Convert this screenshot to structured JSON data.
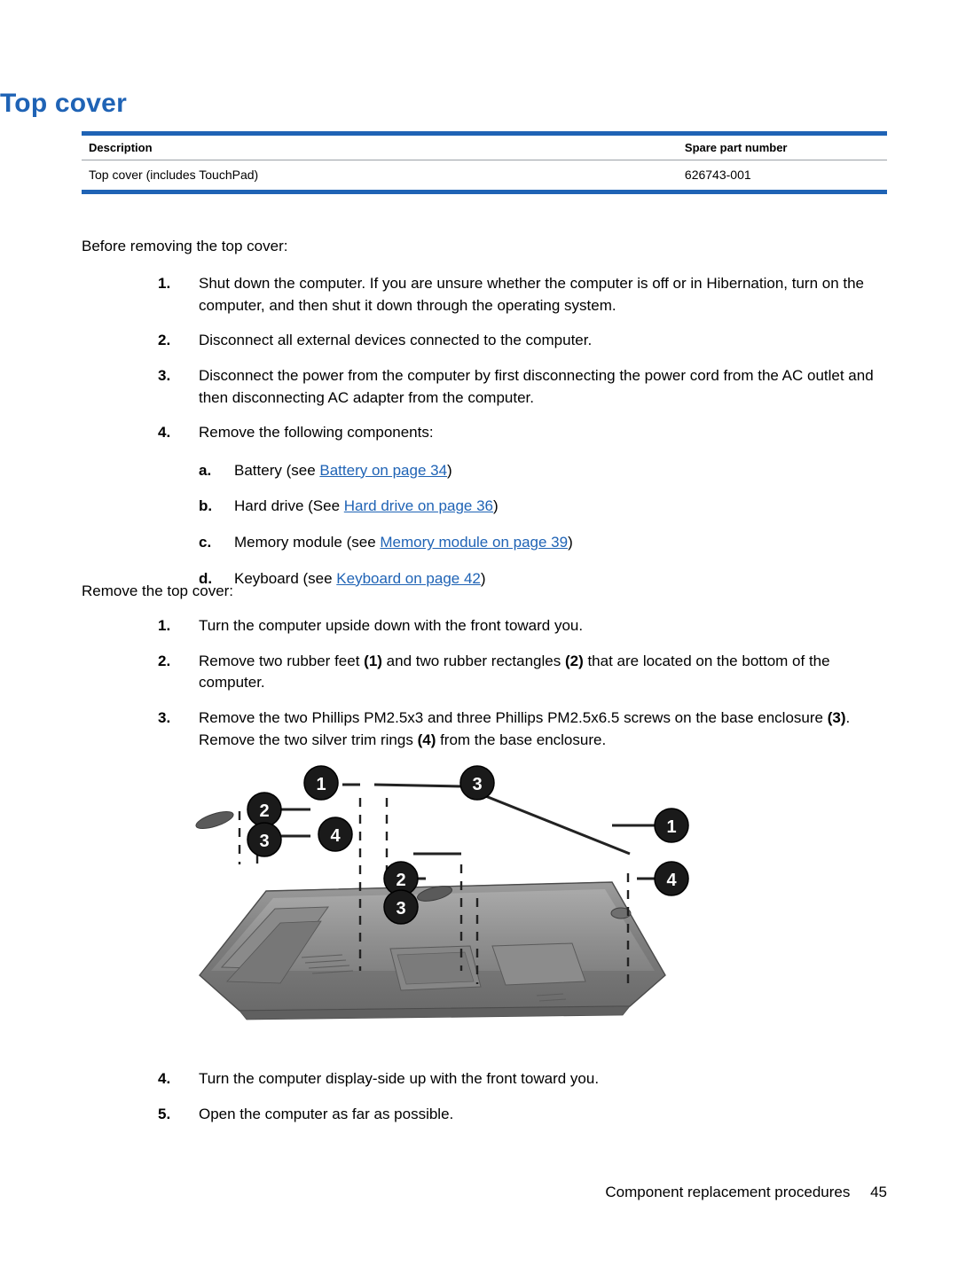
{
  "page": {
    "title": "Top cover",
    "footer_text": "Component replacement procedures",
    "footer_page": "45"
  },
  "table": {
    "headers": [
      "Description",
      "Spare part number"
    ],
    "rows": [
      [
        "Top cover (includes TouchPad)",
        "626743-001"
      ]
    ]
  },
  "intro": {
    "before_heading": "Before removing the top cover:",
    "remove_heading": "Remove the top cover:"
  },
  "before_steps": [
    {
      "marker": "1.",
      "text": "Shut down the computer. If you are unsure whether the computer is off or in Hibernation, turn on the computer, and then shut it down through the operating system."
    },
    {
      "marker": "2.",
      "text": "Disconnect all external devices connected to the computer."
    },
    {
      "marker": "3.",
      "text": "Disconnect the power from the computer by first disconnecting the power cord from the AC outlet and then disconnecting AC adapter from the computer."
    },
    {
      "marker": "4.",
      "text": "Remove the following components:"
    }
  ],
  "components": [
    {
      "marker": "a.",
      "pre": "Battery (see ",
      "link": "Battery on page 34",
      "post": ")"
    },
    {
      "marker": "b.",
      "pre": "Hard drive (See ",
      "link": "Hard drive on page 36",
      "post": ")"
    },
    {
      "marker": "c.",
      "pre": "Memory module (see ",
      "link": "Memory module on page 39",
      "post": ")"
    },
    {
      "marker": "d.",
      "pre": "Keyboard (see ",
      "link": "Keyboard on page 42",
      "post": ")"
    }
  ],
  "remove_steps": [
    {
      "marker": "1.",
      "segments": [
        {
          "type": "text",
          "value": "Turn the computer upside down with the front toward you."
        }
      ]
    },
    {
      "marker": "2.",
      "segments": [
        {
          "type": "text",
          "value": "Remove two rubber feet "
        },
        {
          "type": "bold",
          "value": "(1)"
        },
        {
          "type": "text",
          "value": " and two rubber rectangles "
        },
        {
          "type": "bold",
          "value": "(2)"
        },
        {
          "type": "text",
          "value": " that are located on the bottom of the computer."
        }
      ]
    },
    {
      "marker": "3.",
      "segments": [
        {
          "type": "text",
          "value": "Remove the two Phillips PM2.5x3 and three Phillips PM2.5x6.5 screws on the base enclosure "
        },
        {
          "type": "bold",
          "value": "(3)"
        },
        {
          "type": "text",
          "value": ". Remove the two silver trim rings "
        },
        {
          "type": "bold",
          "value": "(4)"
        },
        {
          "type": "text",
          "value": " from the base enclosure."
        }
      ]
    },
    {
      "marker": "4.",
      "segments": [
        {
          "type": "text",
          "value": "Turn the computer display-side up with the front toward you."
        }
      ]
    },
    {
      "marker": "5.",
      "segments": [
        {
          "type": "text",
          "value": "Open the computer as far as possible."
        }
      ]
    }
  ],
  "figure": {
    "caption": "",
    "callouts": [
      "1",
      "3",
      "2",
      "3",
      "4",
      "1",
      "2",
      "3",
      "4"
    ],
    "accent": "#1f63b5"
  },
  "step2_text_plain": "Remove two rubber feet (1) and two rubber rectangles (2) that are located on the bottom of the computer.",
  "step3_text_plain": "Remove the two Phillips PM2.5x3 and three Phillips PM2.5x6.5 screws on the base enclosure (3). Remove the two silver trim rings (4) from the base enclosure."
}
